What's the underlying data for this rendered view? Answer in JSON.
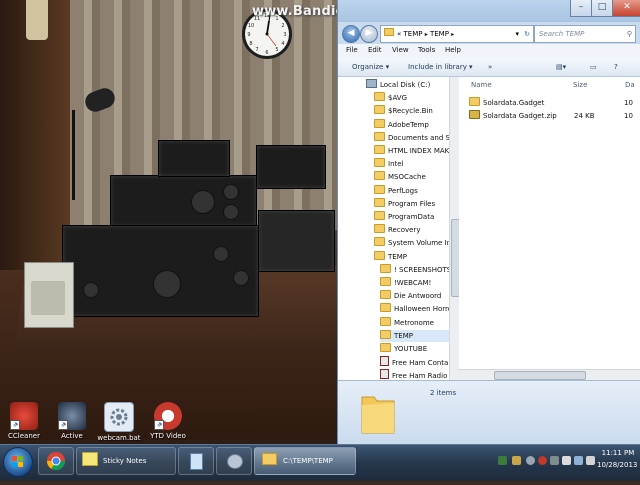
{
  "watermark": "www.Bandicam.com",
  "desktop_icons": [
    {
      "label": "CCleaner",
      "icon": "ccleaner-icon",
      "color": "#c0392b"
    },
    {
      "label": "Active",
      "icon": "active-app-icon",
      "color": "#2e3f5c"
    },
    {
      "label": "webcam.bat",
      "icon": "gear-batch-icon",
      "color": "#d9e3ee"
    },
    {
      "label": "YTD Video",
      "icon": "ytd-video-icon",
      "color": "#c93a2e"
    }
  ],
  "explorer": {
    "window_controls": {
      "minimize": "–",
      "maximize": "□",
      "close": "✕"
    },
    "address": {
      "chevron": "«",
      "crumbs": [
        "TEMP",
        "TEMP"
      ],
      "separator": "▸"
    },
    "search_placeholder": "Search TEMP",
    "menu": [
      "File",
      "Edit",
      "View",
      "Tools",
      "Help"
    ],
    "toolbar": {
      "organize": "Organize ▾",
      "include": "Include in library ▾",
      "more": "»"
    },
    "columns": {
      "name": "Name",
      "size": "Size",
      "date": "Da"
    },
    "nav_tree": [
      {
        "label": "Local Disk (C:)",
        "kind": "drive",
        "indent": 0
      },
      {
        "label": "$AVG",
        "kind": "folder",
        "indent": 1
      },
      {
        "label": "$Recycle.Bin",
        "kind": "folder",
        "indent": 1
      },
      {
        "label": "AdobeTemp",
        "kind": "folder",
        "indent": 1
      },
      {
        "label": "Documents and Se",
        "kind": "folder",
        "indent": 1
      },
      {
        "label": "HTML INDEX MAK",
        "kind": "folder",
        "indent": 1
      },
      {
        "label": "Intel",
        "kind": "folder",
        "indent": 1
      },
      {
        "label": "MSOCache",
        "kind": "folder",
        "indent": 1
      },
      {
        "label": "PerfLogs",
        "kind": "folder",
        "indent": 1
      },
      {
        "label": "Program Files",
        "kind": "folder",
        "indent": 1
      },
      {
        "label": "ProgramData",
        "kind": "folder",
        "indent": 1
      },
      {
        "label": "Recovery",
        "kind": "folder",
        "indent": 1
      },
      {
        "label": "System Volume Inf",
        "kind": "folder",
        "indent": 1
      },
      {
        "label": "TEMP",
        "kind": "folder",
        "indent": 1
      },
      {
        "label": "! SCREENSHOTS",
        "kind": "folder",
        "indent": 2
      },
      {
        "label": "!WEBCAM!",
        "kind": "folder",
        "indent": 2
      },
      {
        "label": "Die Antwoord",
        "kind": "folder",
        "indent": 2
      },
      {
        "label": "Halloween Horro",
        "kind": "folder",
        "indent": 2
      },
      {
        "label": "Metronome",
        "kind": "folder",
        "indent": 2
      },
      {
        "label": "TEMP",
        "kind": "folder",
        "indent": 2,
        "selected": true
      },
      {
        "label": "YOUTUBE",
        "kind": "folder",
        "indent": 2
      },
      {
        "label": "Free Ham Conta",
        "kind": "doc",
        "indent": 2
      },
      {
        "label": "Free Ham Radio",
        "kind": "doc",
        "indent": 2
      }
    ],
    "files": [
      {
        "name": "Solardata.Gadget",
        "kind": "folder",
        "size": "",
        "date": "10"
      },
      {
        "name": "Solardata Gadget.zip",
        "kind": "zip",
        "size": "24 KB",
        "date": "10"
      }
    ],
    "status": "2 items"
  },
  "taskbar": {
    "items": [
      {
        "label": "",
        "icon": "chrome-icon"
      },
      {
        "label": "Sticky Notes",
        "icon": "sticky-notes-icon"
      },
      {
        "label": "",
        "icon": "notepad-icon"
      },
      {
        "label": "",
        "icon": "utility-icon"
      },
      {
        "label": "C:\\TEMP\\TEMP",
        "icon": "folder-icon"
      }
    ],
    "time": "11:11 PM",
    "date": "10/28/2013"
  },
  "colors": {
    "taskbar": "#26374c",
    "explorer_frame": "#c9dcef",
    "folder": "#f3cd63"
  }
}
